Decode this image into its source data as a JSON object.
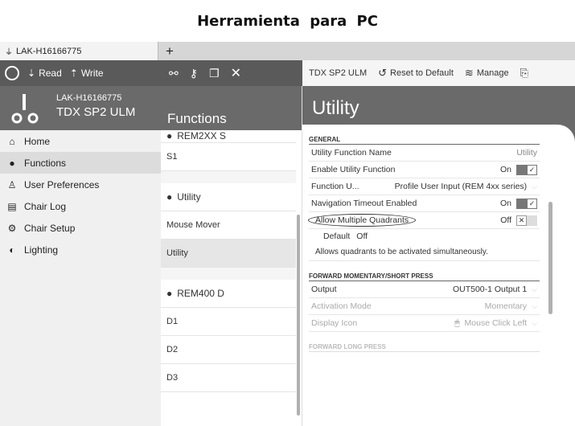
{
  "caption": "Herramienta para PC",
  "tab": {
    "label": "LAK-H16166775",
    "plus": "+"
  },
  "toolbar": {
    "read_label": "Read",
    "write_label": "Write",
    "device_label": "TDX SP2 ULM",
    "reset_label": "Reset to Default",
    "manage_label": "Manage"
  },
  "device": {
    "id": "LAK-H16166775",
    "model": "TDX SP2 ULM"
  },
  "nav": [
    {
      "label": "Home",
      "icon": "home-icon"
    },
    {
      "label": "Functions",
      "icon": "functions-icon"
    },
    {
      "label": "User Preferences",
      "icon": "user-icon"
    },
    {
      "label": "Chair Log",
      "icon": "clipboard-icon"
    },
    {
      "label": "Chair Setup",
      "icon": "chair-setup-icon"
    },
    {
      "label": "Lighting",
      "icon": "lighting-icon"
    }
  ],
  "functions": {
    "title": "Functions",
    "group_prev": "REM2XX S",
    "items_a": [
      "S1"
    ],
    "group_utility": "Utility",
    "items_b": [
      "Mouse Mover",
      "Utility"
    ],
    "group_rem400": "REM400 D",
    "items_c": [
      "D1",
      "D2",
      "D3"
    ]
  },
  "utility": {
    "title": "Utility",
    "general_title": "GENERAL",
    "rows": [
      {
        "label": "Utility Function Name",
        "value": "Utility"
      },
      {
        "label": "Enable Utility Function",
        "value": "On"
      },
      {
        "label": "Function U...",
        "value": "Profile User Input (REM 4xx series)"
      },
      {
        "label": "Navigation Timeout Enabled",
        "value": "On"
      },
      {
        "label": "Allow Multiple Quadrants",
        "value": "Off"
      }
    ],
    "default_label": "Default",
    "default_value": "Off",
    "description": "Allows quadrants to be activated simultaneously.",
    "fwd_title": "FORWARD MOMENTARY/SHORT PRESS",
    "fwd_rows": [
      {
        "label": "Output",
        "value": "OUT500-1 Output 1"
      },
      {
        "label": "Activation Mode",
        "value": "Momentary"
      },
      {
        "label": "Display Icon",
        "value": "Mouse Click Left"
      }
    ],
    "long_title": "FORWARD LONG PRESS"
  },
  "colors": {
    "header_gray": "#6a6a6a",
    "toolbar_dark": "#5a5a5a",
    "selected_bg": "#dcdcdc",
    "toggle_dark": "#777777"
  }
}
